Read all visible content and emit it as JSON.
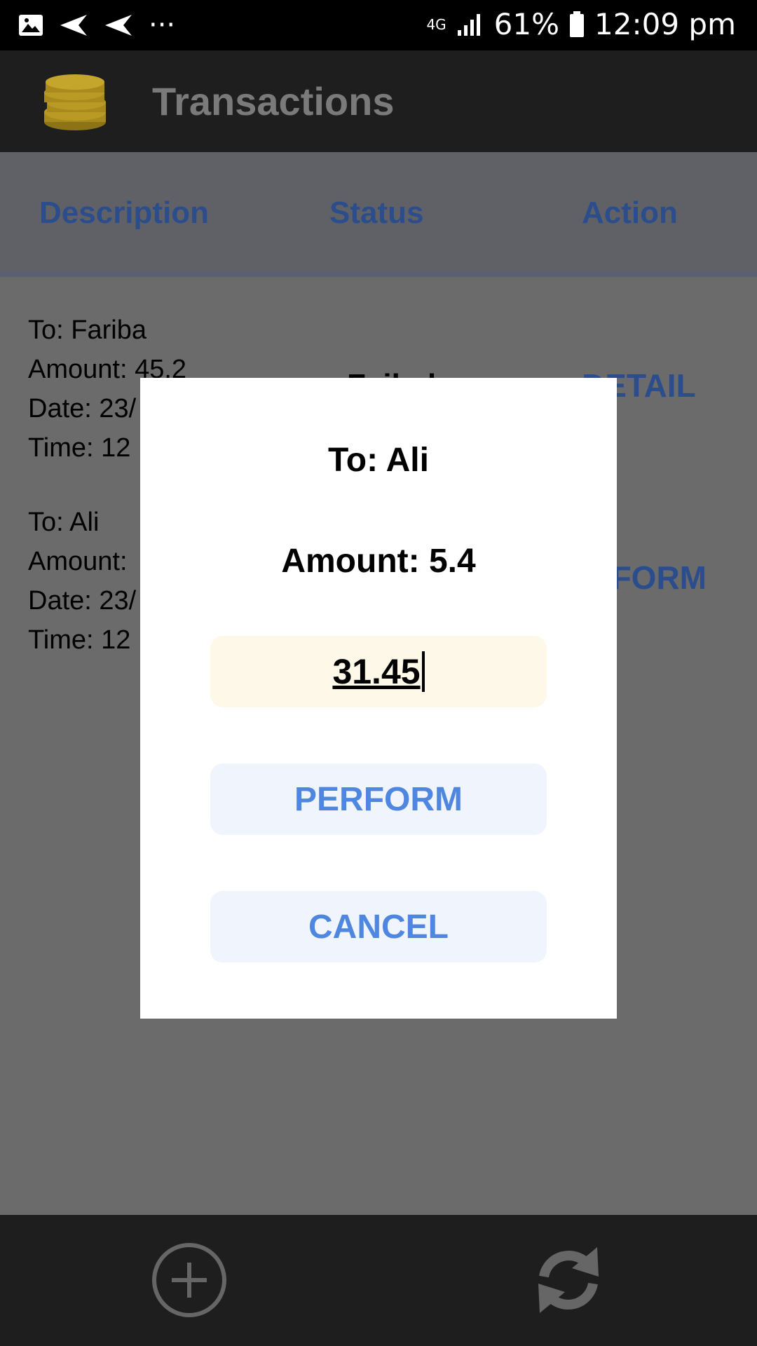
{
  "status_bar": {
    "battery": "61%",
    "time": "12:09 pm",
    "network": "4G"
  },
  "app_bar": {
    "title": "Transactions"
  },
  "columns": {
    "description": "Description",
    "status": "Status",
    "action": "Action"
  },
  "transactions": [
    {
      "to": "To: Fariba",
      "amount": "Amount: 45.2",
      "date": "Date: 23/",
      "time": "Time: 12",
      "status": "Failed",
      "action": "DETAIL"
    },
    {
      "to": "To: Ali",
      "amount": "Amount:",
      "date": "Date: 23/",
      "time": "Time: 12",
      "action": "PERFORM"
    }
  ],
  "dialog": {
    "to": "To: Ali",
    "amount": "Amount: 5.4",
    "input_value": "31.45",
    "perform_label": "PERFORM",
    "cancel_label": "CANCEL"
  },
  "bottom_bar": {
    "add_icon": "add-circle-icon",
    "refresh_icon": "refresh-icon"
  }
}
